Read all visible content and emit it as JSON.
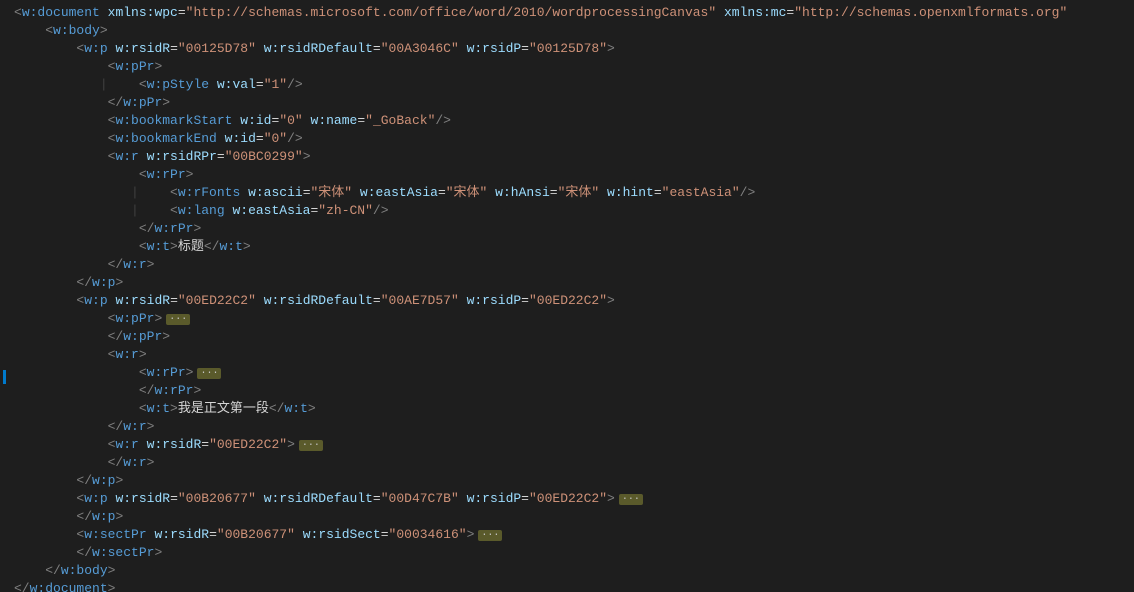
{
  "indent": "    ",
  "lines": [
    {
      "i": 0,
      "t": "otag",
      "name": "w:document",
      "attrs": [
        [
          "xmlns:wpc",
          "http://schemas.microsoft.com/office/word/2010/wordprocessingCanvas"
        ],
        [
          "xmlns:mc",
          "http://schemas.openxmlformats.org"
        ]
      ],
      "cutoff": true
    },
    {
      "i": 1,
      "t": "otag",
      "name": "w:body"
    },
    {
      "i": 2,
      "t": "otag",
      "name": "w:p",
      "attrs": [
        [
          "w:rsidR",
          "00125D78"
        ],
        [
          "w:rsidRDefault",
          "00A3046C"
        ],
        [
          "w:rsidP",
          "00125D78"
        ]
      ]
    },
    {
      "i": 3,
      "t": "otag",
      "name": "w:pPr"
    },
    {
      "i": 4,
      "t": "selfclose",
      "name": "w:pStyle",
      "attrs": [
        [
          "w:val",
          "1"
        ]
      ],
      "guide": true
    },
    {
      "i": 3,
      "t": "ctag",
      "name": "w:pPr"
    },
    {
      "i": 3,
      "t": "selfclose",
      "name": "w:bookmarkStart",
      "attrs": [
        [
          "w:id",
          "0"
        ],
        [
          "w:name",
          "_GoBack"
        ]
      ]
    },
    {
      "i": 3,
      "t": "selfclose",
      "name": "w:bookmarkEnd",
      "attrs": [
        [
          "w:id",
          "0"
        ]
      ]
    },
    {
      "i": 3,
      "t": "otag",
      "name": "w:r",
      "attrs": [
        [
          "w:rsidRPr",
          "00BC0299"
        ]
      ]
    },
    {
      "i": 4,
      "t": "otag",
      "name": "w:rPr"
    },
    {
      "i": 5,
      "t": "selfclose",
      "name": "w:rFonts",
      "attrs": [
        [
          "w:ascii",
          "宋体"
        ],
        [
          "w:eastAsia",
          "宋体"
        ],
        [
          "w:hAnsi",
          "宋体"
        ],
        [
          "w:hint",
          "eastAsia"
        ]
      ],
      "guide": true
    },
    {
      "i": 5,
      "t": "selfclose",
      "name": "w:lang",
      "attrs": [
        [
          "w:eastAsia",
          "zh-CN"
        ]
      ],
      "guide": true
    },
    {
      "i": 4,
      "t": "ctag",
      "name": "w:rPr"
    },
    {
      "i": 4,
      "t": "textnode",
      "name": "w:t",
      "text": "标题"
    },
    {
      "i": 3,
      "t": "ctag",
      "name": "w:r"
    },
    {
      "i": 2,
      "t": "ctag",
      "name": "w:p"
    },
    {
      "i": 2,
      "t": "otag",
      "name": "w:p",
      "attrs": [
        [
          "w:rsidR",
          "00ED22C2"
        ],
        [
          "w:rsidRDefault",
          "00AE7D57"
        ],
        [
          "w:rsidP",
          "00ED22C2"
        ]
      ]
    },
    {
      "i": 3,
      "t": "otag",
      "name": "w:pPr",
      "fold": true
    },
    {
      "i": 3,
      "t": "ctag",
      "name": "w:pPr"
    },
    {
      "i": 3,
      "t": "otag",
      "name": "w:r"
    },
    {
      "i": 4,
      "t": "otag",
      "name": "w:rPr",
      "fold": true
    },
    {
      "i": 4,
      "t": "ctag",
      "name": "w:rPr"
    },
    {
      "i": 4,
      "t": "textnode",
      "name": "w:t",
      "text": "我是正文第一段"
    },
    {
      "i": 3,
      "t": "ctag",
      "name": "w:r"
    },
    {
      "i": 3,
      "t": "otag",
      "name": "w:r",
      "attrs": [
        [
          "w:rsidR",
          "00ED22C2"
        ]
      ],
      "fold": true
    },
    {
      "i": 3,
      "t": "ctag",
      "name": "w:r"
    },
    {
      "i": 2,
      "t": "ctag",
      "name": "w:p"
    },
    {
      "i": 2,
      "t": "otag",
      "name": "w:p",
      "attrs": [
        [
          "w:rsidR",
          "00B20677"
        ],
        [
          "w:rsidRDefault",
          "00D47C7B"
        ],
        [
          "w:rsidP",
          "00ED22C2"
        ]
      ],
      "fold": true
    },
    {
      "i": 2,
      "t": "ctag",
      "name": "w:p"
    },
    {
      "i": 2,
      "t": "otag",
      "name": "w:sectPr",
      "attrs": [
        [
          "w:rsidR",
          "00B20677"
        ],
        [
          "w:rsidSect",
          "00034616"
        ]
      ],
      "fold": true
    },
    {
      "i": 2,
      "t": "ctag",
      "name": "w:sectPr"
    },
    {
      "i": 1,
      "t": "ctag",
      "name": "w:body"
    },
    {
      "i": 0,
      "t": "ctag",
      "name": "w:document"
    }
  ]
}
